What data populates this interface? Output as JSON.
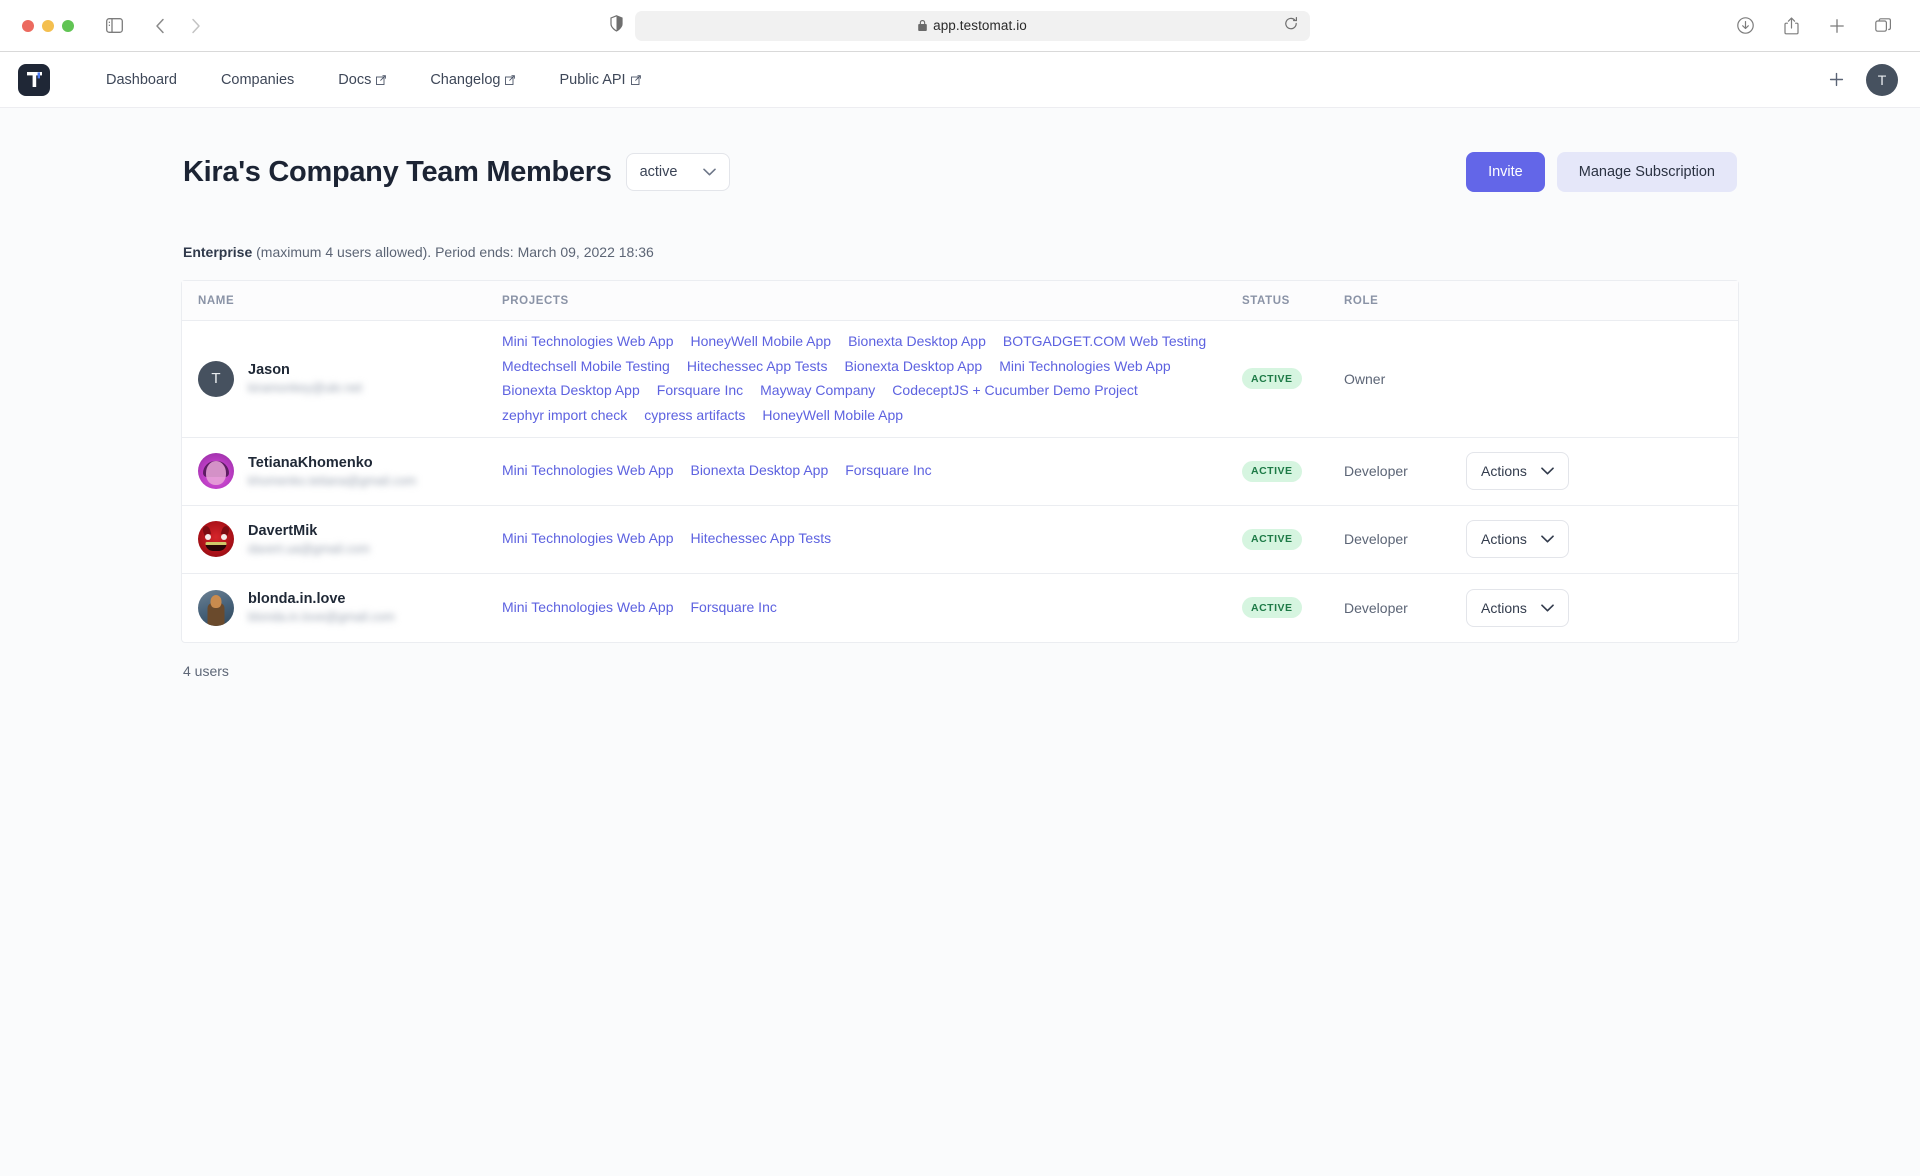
{
  "browser": {
    "url": "app.testomat.io",
    "lock_icon": "lock-icon",
    "reload_icon": "reload-icon",
    "shield_icon": "shield-icon",
    "sidebar_icon": "sidebar-toggle-icon",
    "back_icon": "back-arrow-icon",
    "forward_icon": "forward-arrow-icon",
    "right_icons": [
      "download-icon",
      "share-icon",
      "new-tab-icon",
      "tab-overview-icon"
    ]
  },
  "header": {
    "logo_letter": "T",
    "nav": [
      {
        "label": "Dashboard",
        "external": false
      },
      {
        "label": "Companies",
        "external": false
      },
      {
        "label": "Docs",
        "external": true
      },
      {
        "label": "Changelog",
        "external": true
      },
      {
        "label": "Public API",
        "external": true
      }
    ],
    "plus_icon": "plus-icon",
    "avatar_letter": "T"
  },
  "page": {
    "title": "Kira's Company Team Members",
    "status_filter": {
      "value": "active",
      "chevron": "chevron-down-icon"
    },
    "invite_label": "Invite",
    "manage_subscription_label": "Manage Subscription",
    "plan": {
      "name": "Enterprise",
      "detail": " (maximum 4 users allowed). Period ends: March 09, 2022 18:36"
    },
    "footer_count": "4 users"
  },
  "table": {
    "columns": [
      "NAME",
      "PROJECTS",
      "STATUS",
      "ROLE"
    ],
    "rows": [
      {
        "name": "Jason",
        "email": "kiramonkey@ukr.net",
        "avatar": "initial",
        "avatar_letter": "T",
        "projects": [
          "Mini Technologies Web App",
          "HoneyWell Mobile App",
          "Bionexta Desktop App",
          "BOTGADGET.COM Web Testing",
          "Medtechsell Mobile Testing",
          "Hitechessec App Tests",
          "Bionexta Desktop App",
          "Mini Technologies Web App",
          "Bionexta Desktop App",
          "Forsquare Inc",
          "Mayway Company",
          "CodeceptJS + Cucumber Demo Project",
          "zephyr import check",
          "cypress artifacts",
          "HoneyWell Mobile App"
        ],
        "status": "ACTIVE",
        "role": "Owner",
        "has_actions": false,
        "actions_label": ""
      },
      {
        "name": "TetianaKhomenko",
        "email": "khomenko.tetiana@gmail.com",
        "avatar": "photo-tetiana",
        "avatar_letter": "",
        "projects": [
          "Mini Technologies Web App",
          "Bionexta Desktop App",
          "Forsquare Inc"
        ],
        "status": "ACTIVE",
        "role": "Developer",
        "has_actions": true,
        "actions_label": "Actions"
      },
      {
        "name": "DavertMik",
        "email": "davert.ua@gmail.com",
        "avatar": "photo-davert",
        "avatar_letter": "",
        "projects": [
          "Mini Technologies Web App",
          "Hitechessec App Tests"
        ],
        "status": "ACTIVE",
        "role": "Developer",
        "has_actions": true,
        "actions_label": "Actions"
      },
      {
        "name": "blonda.in.love",
        "email": "blonda.in.love@gmail.com",
        "avatar": "photo-blonda",
        "avatar_letter": "",
        "projects": [
          "Mini Technologies Web App",
          "Forsquare Inc"
        ],
        "status": "ACTIVE",
        "role": "Developer",
        "has_actions": true,
        "actions_label": "Actions"
      }
    ]
  },
  "colors": {
    "accent": "#6366e8",
    "accent_soft": "#e5e7f9",
    "link": "#5d62e0",
    "badge_bg": "#d6f5e0",
    "badge_text": "#1d7a46",
    "page_bg": "#fafbfc"
  }
}
